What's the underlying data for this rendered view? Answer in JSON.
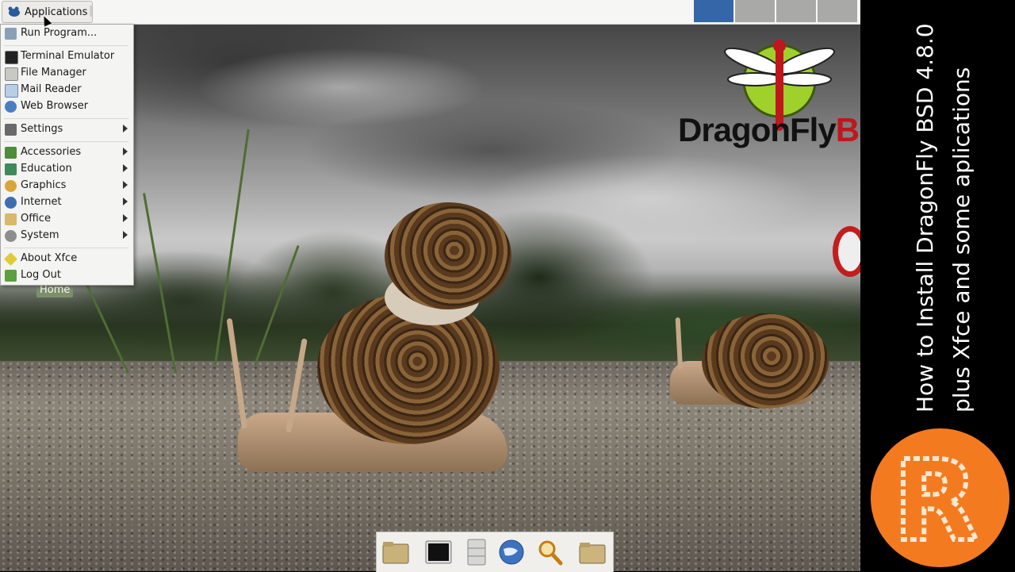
{
  "panel": {
    "applications_label": "Applications",
    "workspaces": [
      {
        "active": true
      },
      {
        "active": false
      },
      {
        "active": false
      },
      {
        "active": false
      }
    ]
  },
  "menu": {
    "items": [
      {
        "label": "Run Program...",
        "icon": "run-icon",
        "submenu": false
      },
      {
        "label": "Terminal Emulator",
        "icon": "terminal-icon",
        "submenu": false
      },
      {
        "label": "File Manager",
        "icon": "file-manager-icon",
        "submenu": false
      },
      {
        "label": "Mail Reader",
        "icon": "mail-icon",
        "submenu": false
      },
      {
        "label": "Web Browser",
        "icon": "web-browser-icon",
        "submenu": false
      },
      {
        "label": "Settings",
        "icon": "settings-icon",
        "submenu": true
      },
      {
        "label": "Accessories",
        "icon": "accessories-icon",
        "submenu": true
      },
      {
        "label": "Education",
        "icon": "education-icon",
        "submenu": true
      },
      {
        "label": "Graphics",
        "icon": "graphics-icon",
        "submenu": true
      },
      {
        "label": "Internet",
        "icon": "internet-icon",
        "submenu": true
      },
      {
        "label": "Office",
        "icon": "office-icon",
        "submenu": true
      },
      {
        "label": "System",
        "icon": "system-icon",
        "submenu": true
      },
      {
        "label": "About Xfce",
        "icon": "about-icon",
        "submenu": false
      },
      {
        "label": "Log Out",
        "icon": "logout-icon",
        "submenu": false
      }
    ]
  },
  "desktop": {
    "home_label": "Home",
    "wallpaper_logo": {
      "dragon_fly": "DragonFly",
      "bs": "BS"
    }
  },
  "dock": {
    "items": [
      {
        "icon": "home-folder-icon"
      },
      {
        "icon": "terminal-icon"
      },
      {
        "icon": "file-cabinet-icon"
      },
      {
        "icon": "web-browser-icon"
      },
      {
        "icon": "search-icon"
      },
      {
        "icon": "folder-icon"
      }
    ]
  },
  "sidebar": {
    "title_line1": "How to Install DragonFly BSD 4.8.0",
    "title_line2": "plus Xfce and some aplications",
    "logo_letter": "R",
    "logo_color": "#f47a20"
  },
  "colors": {
    "panel_bg": "#f6f6f4",
    "workspace_active": "#3466a8",
    "workspace_inactive": "#a9a9a7",
    "logo_red": "#c0161d"
  }
}
